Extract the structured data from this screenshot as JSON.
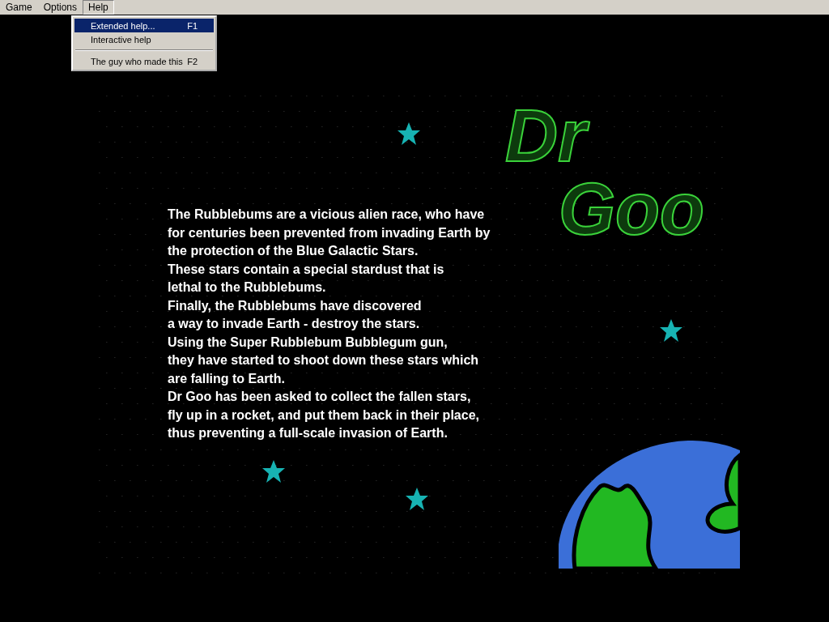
{
  "menu_bar": [
    {
      "label": "Game",
      "selected": false
    },
    {
      "label": "Options",
      "selected": false
    },
    {
      "label": "Help",
      "selected": true
    }
  ],
  "help_menu": {
    "items": [
      {
        "label": "Extended help...",
        "shortcut": "F1",
        "selected": true,
        "kind": "item"
      },
      {
        "label": "Interactive help",
        "selected": false,
        "kind": "item"
      },
      {
        "kind": "separator"
      },
      {
        "label": "The guy who made this",
        "shortcut": "F2",
        "selected": false,
        "kind": "item"
      }
    ]
  },
  "title": {
    "line_1": "Dr",
    "line_2": "Goo"
  },
  "story_lines": [
    "The Rubblebums are a vicious alien race, who have",
    "for centuries been prevented from invading Earth by",
    "the protection of the Blue Galactic Stars.",
    "These stars contain a special stardust that is",
    "lethal to the Rubblebums.",
    "Finally, the Rubblebums have discovered",
    "a way to invade Earth - destroy the stars.",
    "Using the Super Rubblebum Bubblegum gun,",
    "they have started to shoot down these stars which",
    "are falling to Earth.",
    "Dr Goo has been asked to collect the fallen stars,",
    "fly up in a rocket, and put them back in their place,",
    "thus preventing a full-scale invasion of Earth."
  ]
}
